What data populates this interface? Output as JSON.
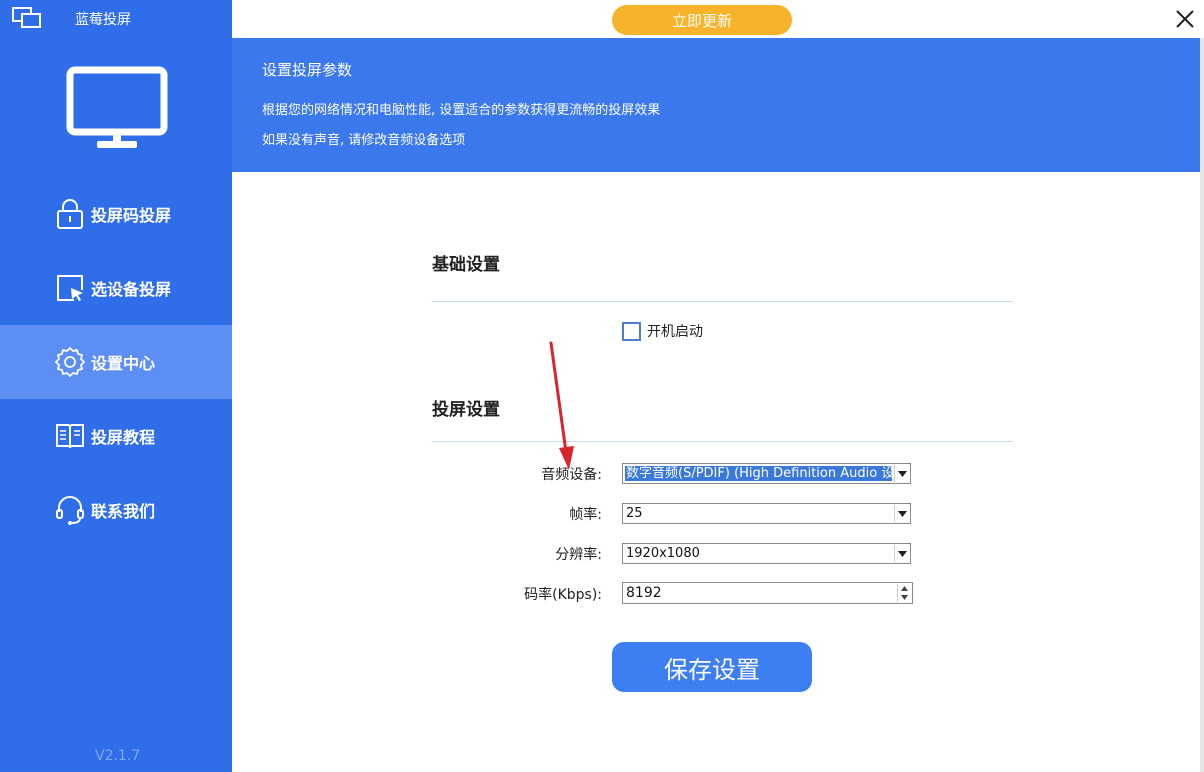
{
  "app": {
    "title": "蓝莓投屏",
    "version": "V2.1.7"
  },
  "topbar": {
    "update_label": "立即更新"
  },
  "sidebar": {
    "items": [
      {
        "label": "投屏码投屏",
        "icon": "lock-icon",
        "active": false
      },
      {
        "label": "选设备投屏",
        "icon": "cursor-select-icon",
        "active": false
      },
      {
        "label": "设置中心",
        "icon": "gear-icon",
        "active": true
      },
      {
        "label": "投屏教程",
        "icon": "book-icon",
        "active": false
      },
      {
        "label": "联系我们",
        "icon": "headset-icon",
        "active": false
      }
    ]
  },
  "banner": {
    "title": "设置投屏参数",
    "line1": "根据您的网络情况和电脑性能, 设置适合的参数获得更流畅的投屏效果",
    "line2": "如果没有声音, 请修改音频设备选项"
  },
  "basic": {
    "title": "基础设置",
    "autostart_label": "开机启动",
    "autostart_checked": false
  },
  "cast": {
    "title": "投屏设置",
    "audio_label": "音频设备:",
    "audio_value": "数字音频(S/PDIF) (High Definition Audio 设备)",
    "framerate_label": "帧率:",
    "framerate_value": "25",
    "resolution_label": "分辨率:",
    "resolution_value": "1920x1080",
    "bitrate_label": "码率(Kbps):",
    "bitrate_value": "8192"
  },
  "save_label": "保存设置",
  "colors": {
    "sidebar": "#2f6ee8",
    "sidebar_active": "#5c8ef3",
    "banner": "#3a78ec",
    "update": "#f7b32b",
    "save": "#3d7ef0",
    "annotation": "#d9262c"
  }
}
